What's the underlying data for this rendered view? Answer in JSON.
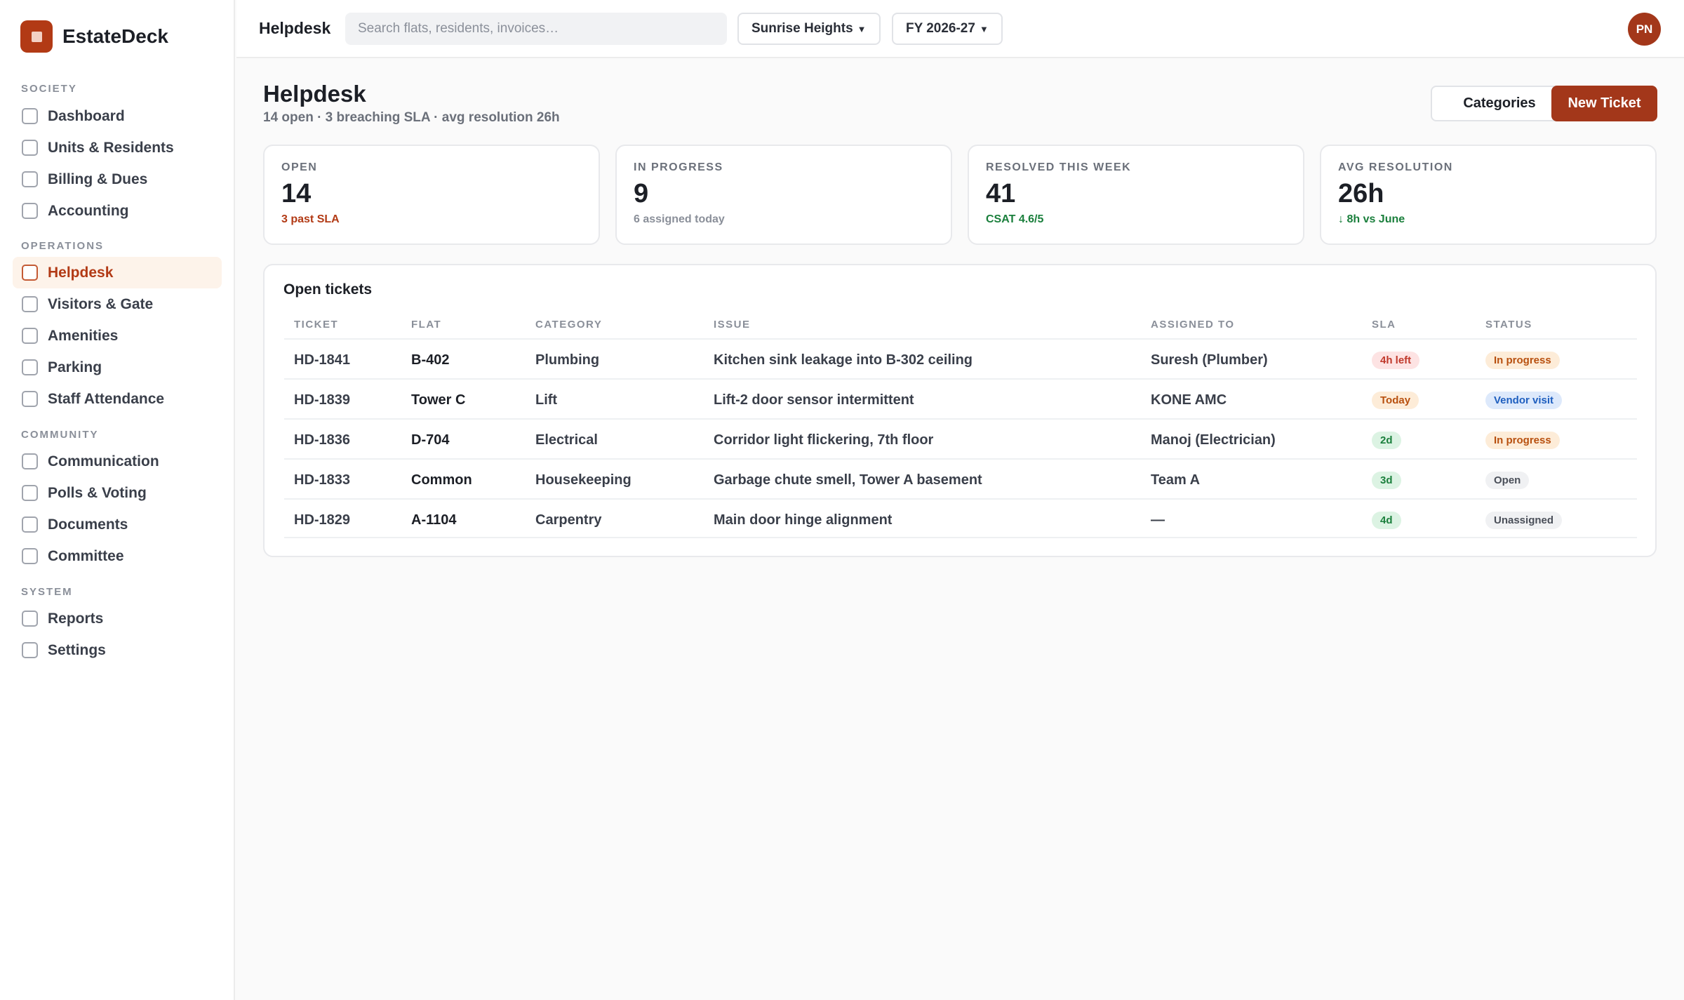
{
  "app": {
    "name": "EstateDeck"
  },
  "sidebar": {
    "sections": [
      {
        "label": "SOCIETY"
      },
      {
        "label": "OPERATIONS"
      },
      {
        "label": "COMMUNITY"
      },
      {
        "label": "SYSTEM"
      }
    ],
    "items": [
      {
        "label": "Dashboard"
      },
      {
        "label": "Units & Residents"
      },
      {
        "label": "Billing & Dues"
      },
      {
        "label": "Accounting"
      },
      {
        "label": "Helpdesk",
        "active": true
      },
      {
        "label": "Visitors & Gate"
      },
      {
        "label": "Amenities"
      },
      {
        "label": "Parking"
      },
      {
        "label": "Staff Attendance"
      },
      {
        "label": "Communication"
      },
      {
        "label": "Polls & Voting"
      },
      {
        "label": "Documents"
      },
      {
        "label": "Committee"
      },
      {
        "label": "Reports"
      },
      {
        "label": "Settings"
      }
    ]
  },
  "topbar": {
    "title": "Helpdesk",
    "search_placeholder": "Search flats, residents, invoices…",
    "society": "Sunrise Heights",
    "fiscal_year": "FY 2026-27",
    "user_initials": "PN"
  },
  "page": {
    "title": "Helpdesk",
    "subtitle": "14 open · 3 breaching SLA · avg resolution 26h",
    "categories_button": "Categories",
    "new_ticket_button": "New Ticket"
  },
  "stats": [
    {
      "label": "OPEN",
      "value": "14",
      "note": "3 past SLA",
      "note_color": "#b23a15"
    },
    {
      "label": "IN PROGRESS",
      "value": "9",
      "note": "6 assigned today",
      "note_color": "#8a8f99"
    },
    {
      "label": "RESOLVED THIS WEEK",
      "value": "41",
      "note": "CSAT 4.6/5",
      "note_color": "#1a7f3c"
    },
    {
      "label": "AVG RESOLUTION",
      "value": "26h",
      "note": "↓ 8h vs June",
      "note_color": "#1a7f3c"
    }
  ],
  "tickets": {
    "title": "Open tickets",
    "columns": [
      "TICKET",
      "FLAT",
      "CATEGORY",
      "ISSUE",
      "ASSIGNED TO",
      "SLA",
      "STATUS"
    ],
    "rows": [
      {
        "ticket": "HD-1841",
        "flat": "B-402",
        "category": "Plumbing",
        "issue": "Kitchen sink leakage into B-302 ceiling",
        "assigned": "Suresh (Plumber)",
        "sla": "4h left",
        "sla_tone": "danger",
        "status": "In progress",
        "status_tone": "warn"
      },
      {
        "ticket": "HD-1839",
        "flat": "Tower C",
        "category": "Lift",
        "issue": "Lift-2 door sensor intermittent",
        "assigned": "KONE AMC",
        "sla": "Today",
        "sla_tone": "warn",
        "status": "Vendor visit",
        "status_tone": "info"
      },
      {
        "ticket": "HD-1836",
        "flat": "D-704",
        "category": "Electrical",
        "issue": "Corridor light flickering, 7th floor",
        "assigned": "Manoj (Electrician)",
        "sla": "2d",
        "sla_tone": "ok",
        "status": "In progress",
        "status_tone": "warn"
      },
      {
        "ticket": "HD-1833",
        "flat": "Common",
        "category": "Housekeeping",
        "issue": "Garbage chute smell, Tower A basement",
        "assigned": "Team A",
        "sla": "3d",
        "sla_tone": "ok",
        "status": "Open",
        "status_tone": "neutral"
      },
      {
        "ticket": "HD-1829",
        "flat": "A-1104",
        "category": "Carpentry",
        "issue": "Main door hinge alignment",
        "assigned": "—",
        "sla": "4d",
        "sla_tone": "ok",
        "status": "Unassigned",
        "status_tone": "neutral"
      }
    ]
  },
  "tones": {
    "danger": {
      "bg": "#fde3e3",
      "fg": "#c0392b"
    },
    "warn": {
      "bg": "#fdecd8",
      "fg": "#b8500f"
    },
    "ok": {
      "bg": "#dcf3e3",
      "fg": "#1a7f3c"
    },
    "info": {
      "bg": "#dde9fb",
      "fg": "#1f5fbf"
    },
    "neutral": {
      "bg": "#f0f1f3",
      "fg": "#4a4f59"
    }
  }
}
